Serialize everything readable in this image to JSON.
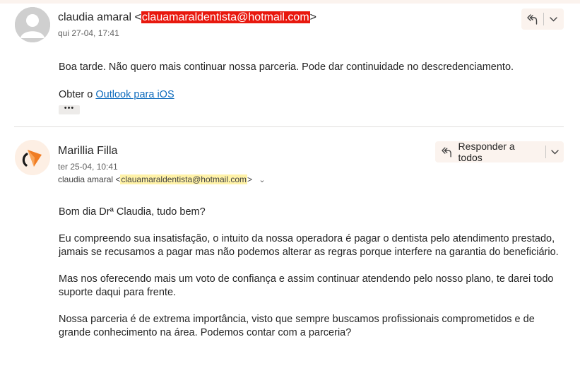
{
  "message1": {
    "sender_name": "claudia amaral",
    "open_bracket": " <",
    "sender_email": "clauamaraldentista@hotmail.com",
    "close_bracket": ">",
    "date": "qui 27-04, 17:41",
    "body_line": "Boa tarde. Não quero mais continuar nossa parceria. Pode dar continuidade no descredenciamento.",
    "signature_prefix": "Obter o ",
    "signature_link": "Outlook para iOS",
    "more_label": "•••"
  },
  "message2": {
    "sender_name": "Marillia Filla",
    "date": "ter 25-04, 10:41",
    "to_name": "claudia amaral <",
    "to_email": "clauamaraldentista@hotmail.com",
    "to_close": ">",
    "reply_all_label": "Responder a todos",
    "paragraphs": [
      "Bom dia Drª Claudia, tudo bem?",
      "Eu compreendo sua insatisfação, o intuito da nossa operadora é pagar o dentista pelo atendimento prestado, jamais se recusamos a pagar mas não podemos alterar as regras porque interfere na garantia do beneficiário.",
      "Mas nos oferecendo mais um voto de confiança e assim continuar atendendo pelo nosso plano, te darei todo suporte daqui para frente.",
      "Nossa parceria é de extrema importância, visto que sempre buscamos profissionais comprometidos e de grande conhecimento na área. Podemos contar com a parceria?"
    ]
  },
  "icons": {
    "reply_all": "reply-all-icon",
    "chevron": "chevron-down-icon",
    "expand": "double-chevron-down-icon"
  },
  "colors": {
    "redacted_highlight": "#e8180e",
    "email_highlight": "#fff2a8",
    "link": "#0f6cbd",
    "button_bg": "#fbf3ee",
    "brand_orange": "#f07d24"
  }
}
